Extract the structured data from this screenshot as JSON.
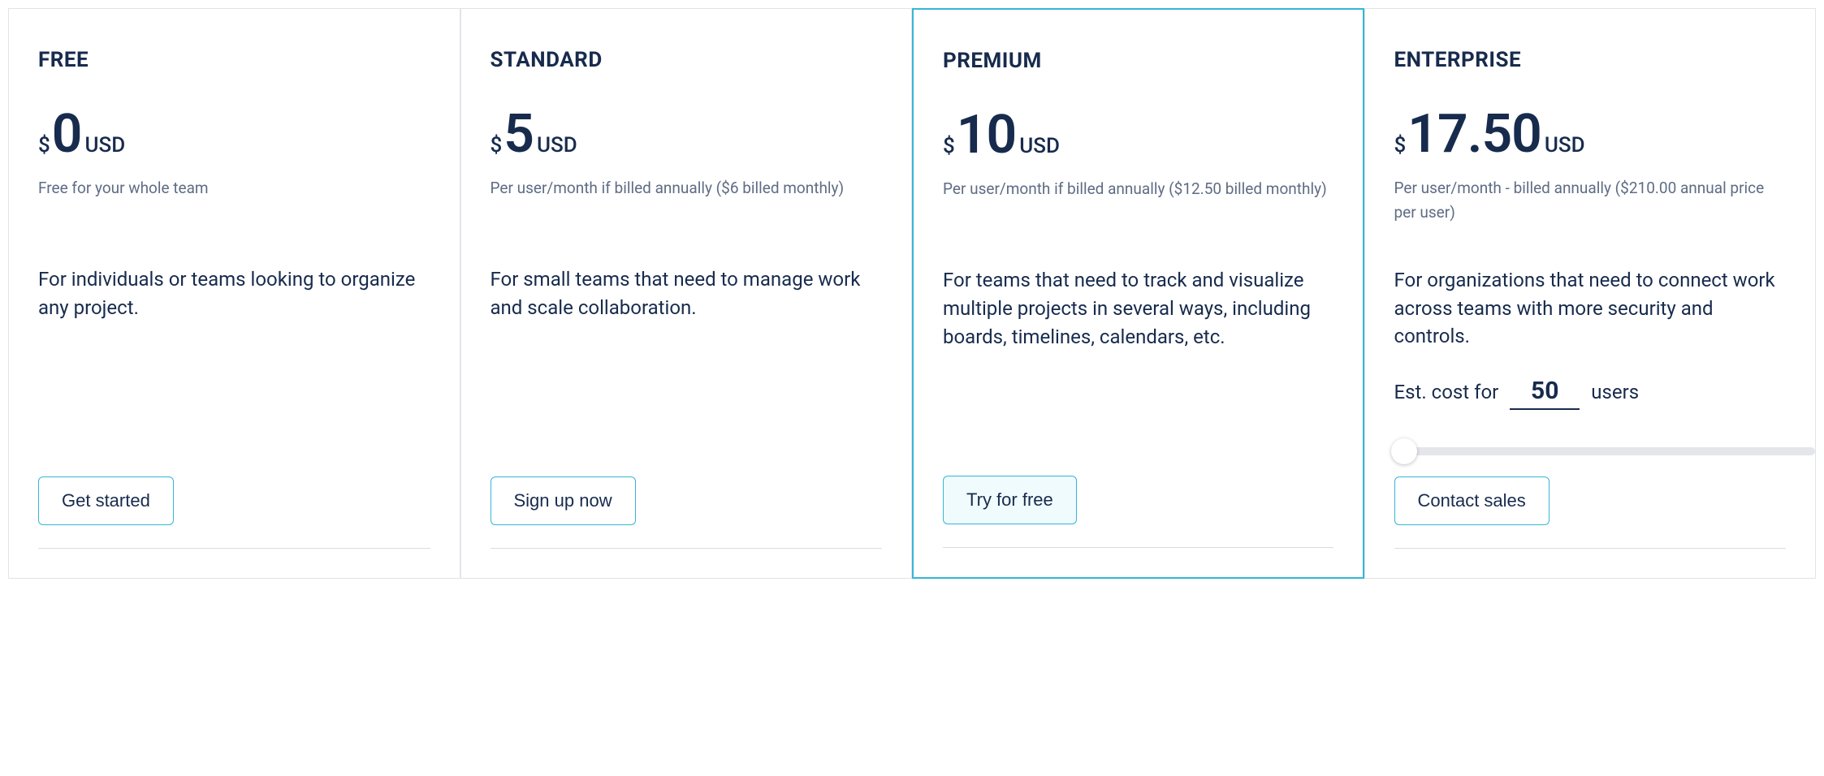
{
  "currency_symbol": "$",
  "currency_code": "USD",
  "plans": [
    {
      "title": "FREE",
      "price": "0",
      "billing_note": "Free for your whole team",
      "description": "For individuals or teams looking to organize any project.",
      "cta": "Get started"
    },
    {
      "title": "STANDARD",
      "price": "5",
      "billing_note": "Per user/month if billed annually ($6 billed monthly)",
      "description": "For small teams that need to manage work and scale collaboration.",
      "cta": "Sign up now"
    },
    {
      "title": "PREMIUM",
      "price": "10",
      "billing_note": "Per user/month if billed annually ($12.50 billed monthly)",
      "description": "For teams that need to track and visualize multiple projects in several ways, including boards, timelines, calendars, etc.",
      "cta": "Try for free"
    },
    {
      "title": "ENTERPRISE",
      "price": "17.50",
      "billing_note": "Per user/month - billed annually ($210.00 annual price per user)",
      "description": "For organizations that need to connect work across teams with more security and controls.",
      "cta": "Contact sales",
      "est_cost_label_prefix": "Est. cost for",
      "est_cost_value": "50",
      "est_cost_label_suffix": "users"
    }
  ]
}
